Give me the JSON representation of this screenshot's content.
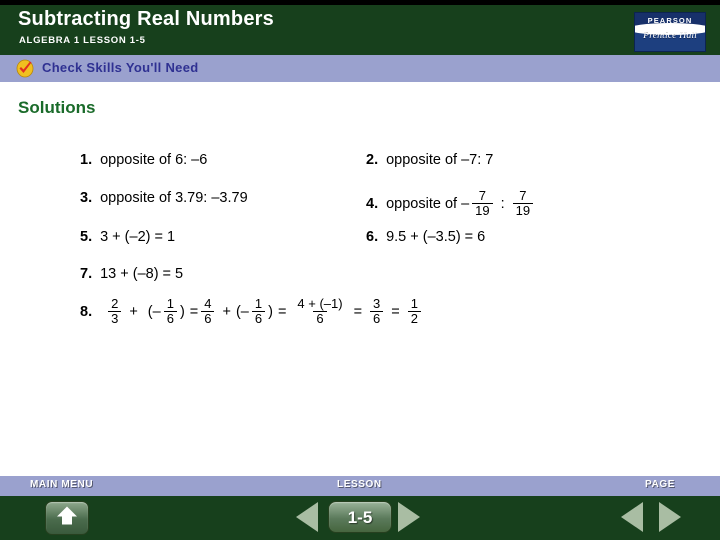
{
  "colors": {
    "header_green": "#17401c",
    "banner_periwinkle": "#9aa1ce",
    "banner_text": "#2f3192",
    "solutions_green": "#1a6b2a",
    "arrow_sage": "#a9bda3"
  },
  "header": {
    "title": "Subtracting Real Numbers",
    "subtitle": "ALGEBRA 1  LESSON 1-5",
    "logo": {
      "top_text": "PEARSON",
      "bottom_text": "Prentice Hall"
    }
  },
  "banner": {
    "icon": "check-badge-icon",
    "label": "Check Skills You'll Need"
  },
  "main": {
    "heading": "Solutions",
    "problems": [
      {
        "number": "1.",
        "text": "opposite of 6: –6"
      },
      {
        "number": "2.",
        "text": "opposite of –7: 7"
      },
      {
        "number": "3.",
        "text": "opposite of 3.79: –3.79"
      },
      {
        "number": "4.",
        "prefix": "opposite of –",
        "frac1_num": "7",
        "frac1_den": "19",
        "colon": ":",
        "frac2_num": "7",
        "frac2_den": "19"
      },
      {
        "number": "5.",
        "text": "3 + (–2) = 1"
      },
      {
        "number": "6.",
        "text": "9.5 + (–3.5) = 6"
      },
      {
        "number": "7.",
        "text": "13 + (–8) = 5"
      },
      {
        "number": "8.",
        "f1_num": "2",
        "f1_den": "3",
        "op1": "+",
        "paren_open1": "(–",
        "f2_num": "1",
        "f2_den": "6",
        "paren_close1": ")",
        "eq1": "=",
        "f3_num": "4",
        "f3_den": "6",
        "op2": "+",
        "paren_open2": "(–",
        "f4_num": "1",
        "f4_den": "6",
        "paren_close2": ")",
        "eq2": "=",
        "f5_num": "4 + (–1)",
        "f5_den": "6",
        "eq3": "=",
        "f6_num": "3",
        "f6_den": "6",
        "eq4": "=",
        "f7_num": "1",
        "f7_den": "2"
      }
    ]
  },
  "footer": {
    "main_menu_label": "MAIN MENU",
    "lesson_label": "LESSON",
    "page_label": "PAGE",
    "lesson_number": "1-5",
    "home_icon": "home-icon",
    "lesson_prev_icon": "triangle-left-icon",
    "lesson_next_icon": "triangle-right-icon",
    "page_prev_icon": "triangle-left-icon",
    "page_next_icon": "triangle-right-icon"
  }
}
